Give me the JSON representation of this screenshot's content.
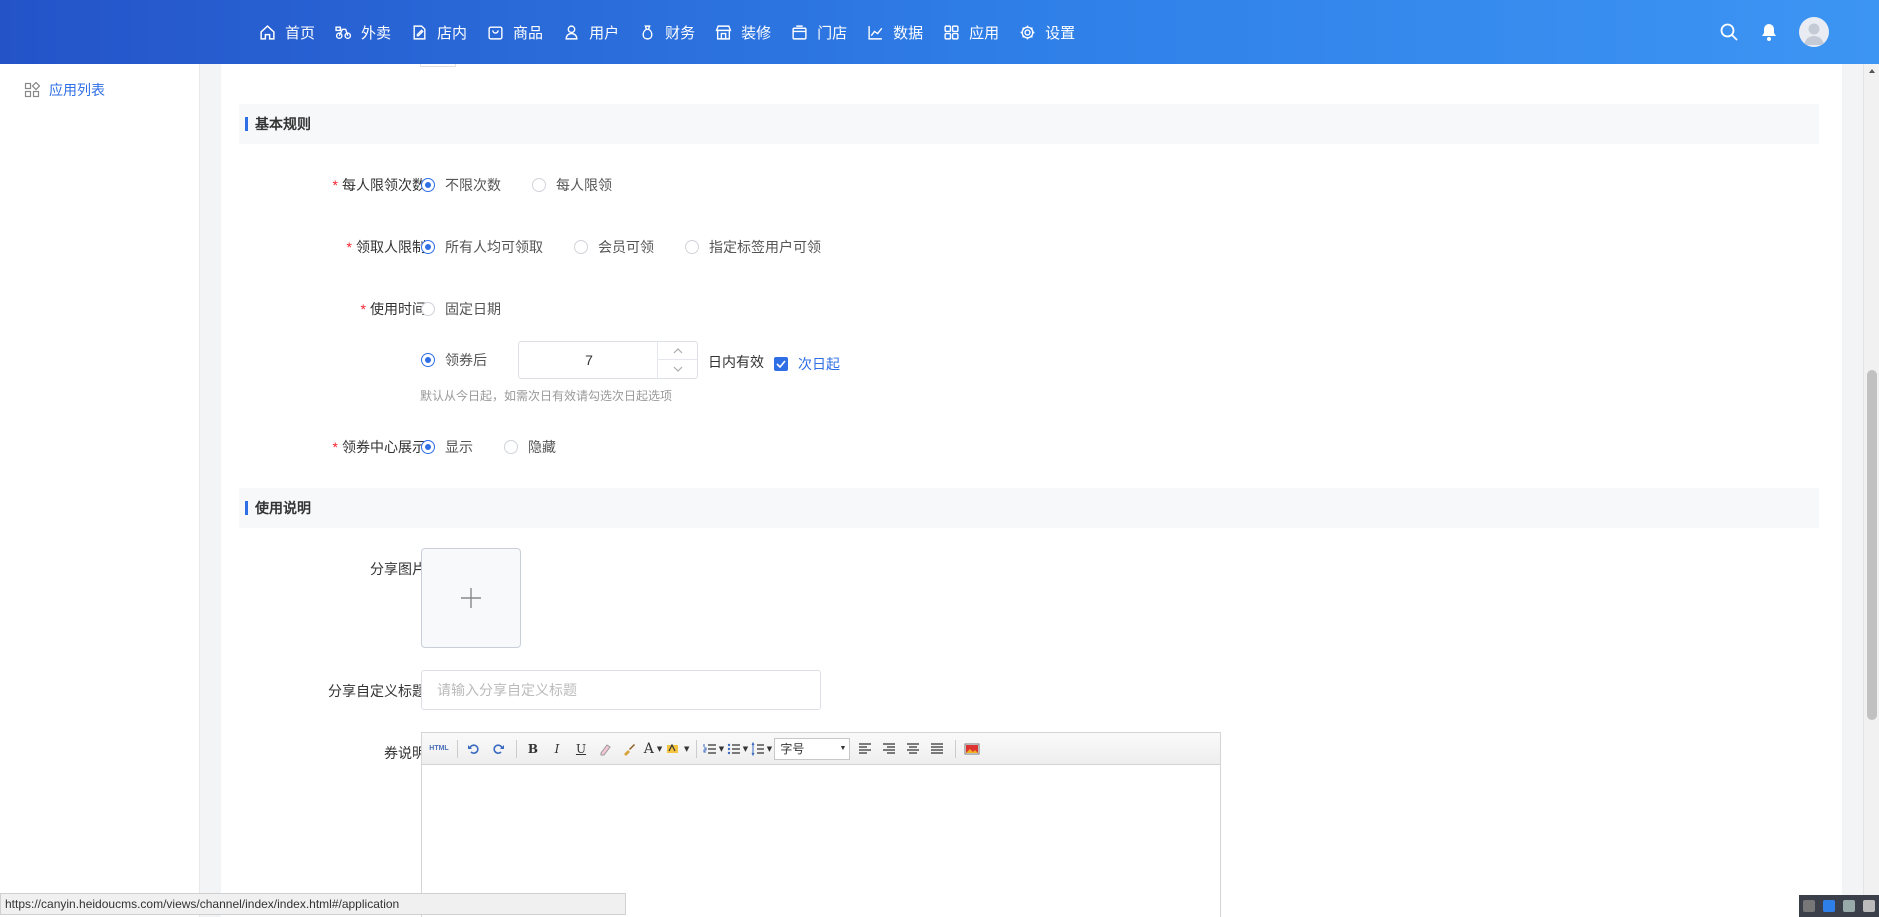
{
  "nav": {
    "items": [
      {
        "label": "首页",
        "icon": "home-icon"
      },
      {
        "label": "外卖",
        "icon": "bike-icon"
      },
      {
        "label": "店内",
        "icon": "edit-icon"
      },
      {
        "label": "商品",
        "icon": "bag-icon"
      },
      {
        "label": "用户",
        "icon": "user-icon"
      },
      {
        "label": "财务",
        "icon": "money-bag-icon"
      },
      {
        "label": "装修",
        "icon": "shop-icon"
      },
      {
        "label": "门店",
        "icon": "store-icon"
      },
      {
        "label": "数据",
        "icon": "chart-icon"
      },
      {
        "label": "应用",
        "icon": "grid-icon"
      },
      {
        "label": "设置",
        "icon": "gear-icon"
      }
    ]
  },
  "sidebar": {
    "items": [
      {
        "label": "应用列表",
        "icon": "apps-icon"
      }
    ]
  },
  "sections": {
    "rules": "基本规则",
    "usage": "使用说明"
  },
  "form": {
    "limit": {
      "label": "每人限领次数",
      "options": [
        "不限次数",
        "每人限领"
      ],
      "selected": "不限次数"
    },
    "receiver": {
      "label": "领取人限制",
      "options": [
        "所有人均可领取",
        "会员可领",
        "指定标签用户可领"
      ],
      "selected": "所有人均可领取"
    },
    "usetime": {
      "label": "使用时间",
      "option_fixed": "固定日期",
      "option_after": "领券后",
      "days_value": "7",
      "days_suffix": "日内有效",
      "next_day_label": "次日起",
      "next_day_checked": true,
      "hint": "默认从今日起，如需次日有效请勾选次日起选项"
    },
    "center": {
      "label": "领券中心展示",
      "options": [
        "显示",
        "隐藏"
      ],
      "selected": "显示"
    },
    "share_image": {
      "label": "分享图片"
    },
    "share_title": {
      "label": "分享自定义标题",
      "placeholder": "请输入分享自定义标题",
      "value": ""
    },
    "desc": {
      "label": "券说明",
      "toolbar_html": "HTML",
      "font_size": "字号",
      "tb_bold": "B",
      "tb_italic": "I",
      "tb_underline": "U",
      "tb_font_color": "A"
    }
  },
  "statusbar": {
    "url": "https://canyin.heidoucms.com/views/channel/index/index.html#/application"
  },
  "colors": {
    "primary": "#2f6fe6",
    "required": "#f5222d",
    "nav_start": "#2453c8",
    "nav_end": "#3d95f3"
  }
}
